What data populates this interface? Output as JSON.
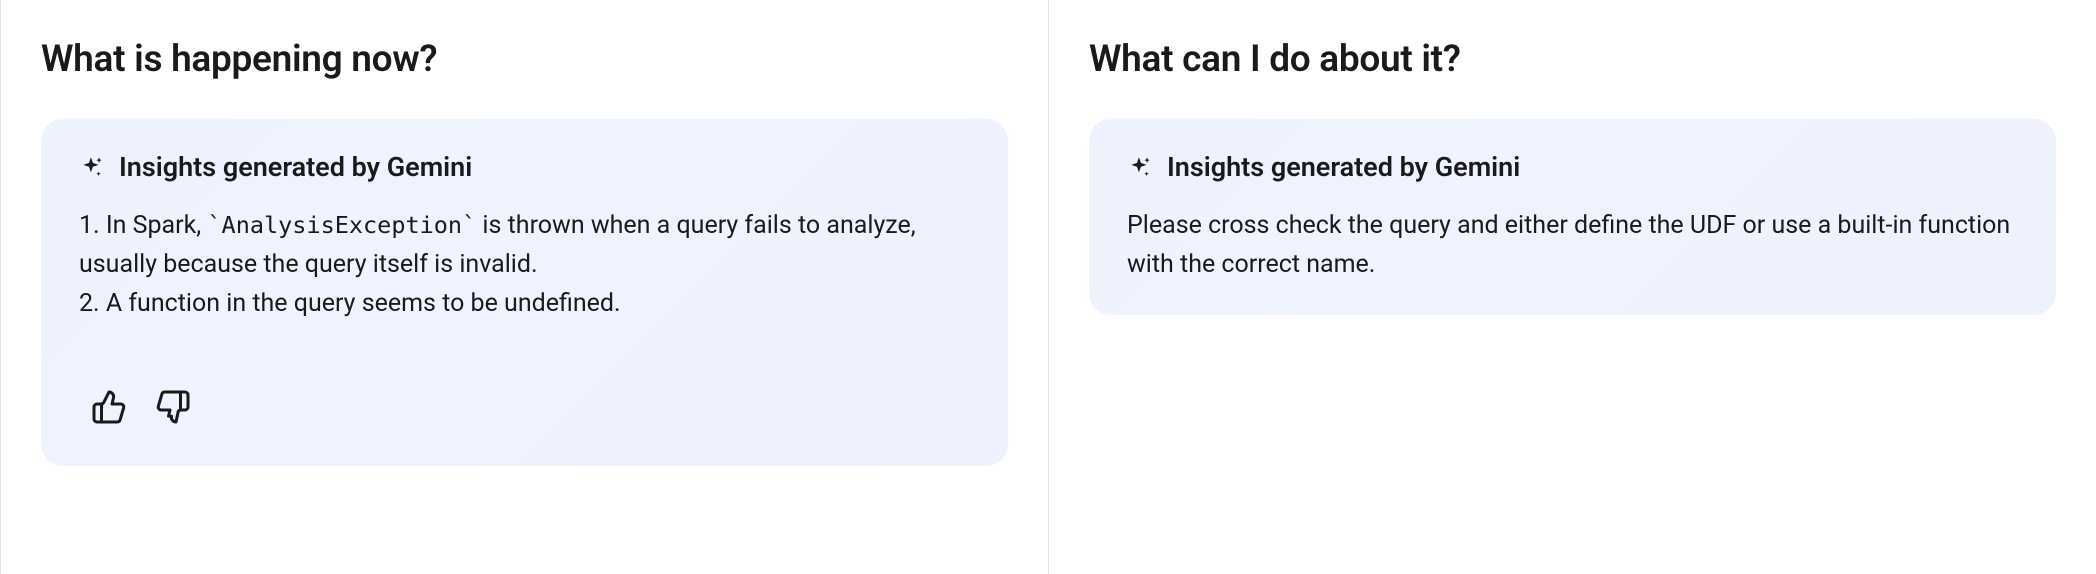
{
  "left": {
    "heading": "What is happening now?",
    "card": {
      "title": "Insights generated by Gemini",
      "body_line1_prefix": "1. In Spark, ",
      "body_line1_code": "`AnalysisException`",
      "body_line1_suffix": " is thrown when a query fails to analyze, usually because the query itself is invalid.",
      "body_line2": "2. A function in the query seems to be undefined."
    }
  },
  "right": {
    "heading": "What can I do about it?",
    "card": {
      "title": "Insights generated by Gemini",
      "body": "Please cross check the query and either define the UDF or use a built-in function with the correct name."
    }
  }
}
